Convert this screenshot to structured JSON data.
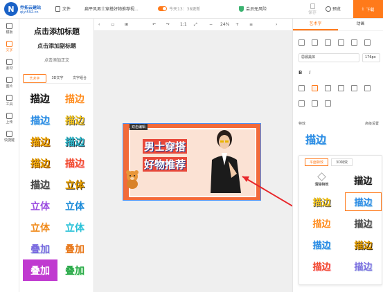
{
  "topbar": {
    "logo_line1": "乔拓云建站",
    "logo_line2": "qiyt592.cn",
    "file_label": "文件",
    "doc_title": "扁平风男士穿搭好物推荐视...",
    "autosave_text": "今天13：38更新",
    "safe_text": "会员无风险",
    "save_label": "保存",
    "preview_label": "预览",
    "download_label": "下载"
  },
  "rail": [
    {
      "label": "模板",
      "icon": "template-icon"
    },
    {
      "label": "文字",
      "icon": "text-icon"
    },
    {
      "label": "素材",
      "icon": "material-icon"
    },
    {
      "label": "图片",
      "icon": "image-icon"
    },
    {
      "label": "工具",
      "icon": "tools-icon"
    },
    {
      "label": "上传",
      "icon": "upload-icon"
    },
    {
      "label": "快捷键",
      "icon": "shortcut-icon"
    }
  ],
  "panel": {
    "add_title": "点击添加标题",
    "add_subtitle": "点击添加副标题",
    "add_body": "点击添加正文",
    "tabs": [
      "艺术字",
      "3D文字",
      "文字组合"
    ],
    "styles": [
      "描边",
      "描边",
      "描边",
      "描边",
      "描边",
      "描边",
      "描边",
      "描边",
      "描边",
      "描边",
      "描边",
      "立体",
      "立体",
      "立体",
      "立体",
      "立体",
      "叠加",
      "叠加",
      "叠加",
      "叠加"
    ]
  },
  "canvas_toolbar": {
    "zoom": "24%",
    "page_ratio": "1:1"
  },
  "poster": {
    "tag": "双击编辑",
    "title1": "男士穿搭",
    "title2": "好物推荐"
  },
  "props": {
    "tabs": [
      "艺术字",
      "动画"
    ],
    "font_name": "思源黑体",
    "font_size": "176px",
    "fx_label": "特效",
    "fx_adv": "高级设置",
    "fx_preview": "描边",
    "fx_tabs": [
      "平面特效",
      "3D特效"
    ],
    "clear_label": "清除特效",
    "fx_items": [
      "描边",
      "描边",
      "描边",
      "描边",
      "描边",
      "描边",
      "描边",
      "描边",
      "描边",
      "描边",
      "描边"
    ]
  },
  "colors": {
    "accent": "#ff7a1a",
    "brand": "#1a62c7",
    "poster_bg": "#f26a3a"
  }
}
